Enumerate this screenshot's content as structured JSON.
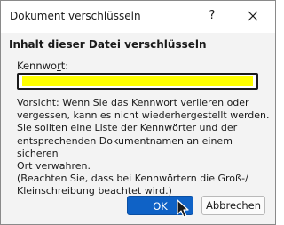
{
  "window": {
    "title": "Dokument verschlüsseln",
    "help_icon": "?",
    "close_icon": "close-icon"
  },
  "dialog": {
    "heading": "Inhalt dieser Datei verschlüsseln",
    "password_label_prefix": "Kennwo",
    "password_label_accel": "r",
    "password_label_suffix": "t:",
    "password_value": "",
    "warning_text": "Vorsicht: Wenn Sie das Kennwort verlieren oder\nvergessen, kann es nicht wiederhergestellt werden.\nSie sollten eine Liste der Kennwörter und der\nentsprechenden Dokumentnamen an einem sicheren\nOrt verwahren.\n(Beachten Sie, dass bei Kennwörtern die Groß-/\nKleinschreibung beachtet wird.)"
  },
  "buttons": {
    "ok_label": "OK",
    "cancel_label": "Abbrechen"
  },
  "colors": {
    "accent": "#0f62c6",
    "input_highlight": "#ffff00"
  }
}
